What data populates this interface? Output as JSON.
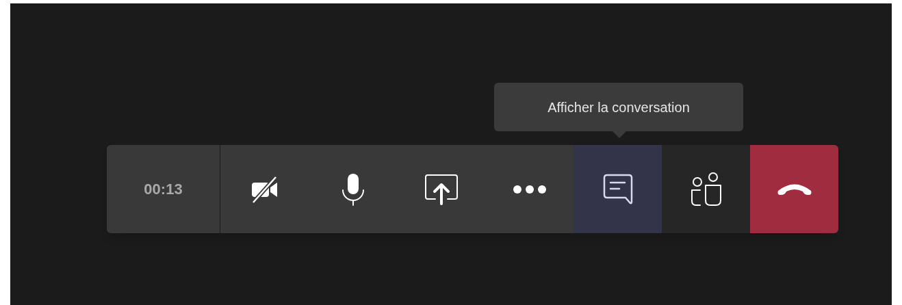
{
  "tooltip": {
    "text": "Afficher la conversation"
  },
  "call_bar": {
    "timer": "00:13",
    "buttons": [
      {
        "kind": "camera",
        "on": false,
        "selected": false
      },
      {
        "kind": "mic",
        "on": true,
        "selected": false
      },
      {
        "kind": "share",
        "selected": false
      },
      {
        "kind": "more",
        "selected": false
      },
      {
        "kind": "chat",
        "selected": true
      },
      {
        "kind": "people",
        "selected": false
      },
      {
        "kind": "hangup",
        "selected": false
      }
    ]
  }
}
